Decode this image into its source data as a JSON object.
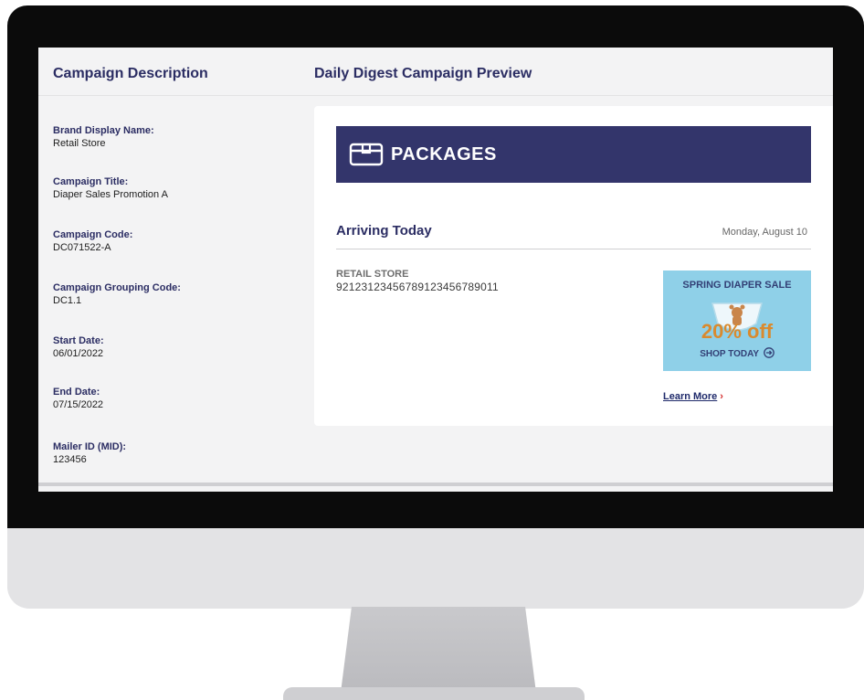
{
  "left_panel": {
    "title": "Campaign Description",
    "fields": [
      {
        "label": "Brand Display Name:",
        "value": "Retail Store"
      },
      {
        "label": "Campaign Title:",
        "value": "Diaper Sales Promotion A"
      },
      {
        "label": "Campaign Code:",
        "value": "DC071522-A"
      },
      {
        "label": "Campaign Grouping Code:",
        "value": "DC1.1"
      },
      {
        "label": "Start Date:",
        "value": "06/01/2022"
      },
      {
        "label": "End Date:",
        "value": "07/15/2022"
      },
      {
        "label": "Mailer ID (MID):",
        "value": "123456"
      }
    ]
  },
  "preview": {
    "title": "Daily Digest Campaign Preview",
    "banner": {
      "icon": "package-icon",
      "label": "PACKAGES"
    },
    "section_title": "Arriving Today",
    "date": "Monday, August 10",
    "store_name": "RETAIL STORE",
    "tracking_number": "9212312345678912345678901​1",
    "promo": {
      "title": "SPRING DIAPER SALE",
      "discount": "20% off",
      "cta": "SHOP TODAY",
      "cta_icon": "arrow-right-circle-icon"
    },
    "learn_more": "Learn More",
    "learn_more_icon": "chevron-right-icon"
  },
  "colors": {
    "navy": "#33356b",
    "heading": "#2b2d63",
    "promo_bg": "#8fd0e8",
    "promo_accent": "#d98a2e",
    "link_chevron": "#d42b2b"
  }
}
